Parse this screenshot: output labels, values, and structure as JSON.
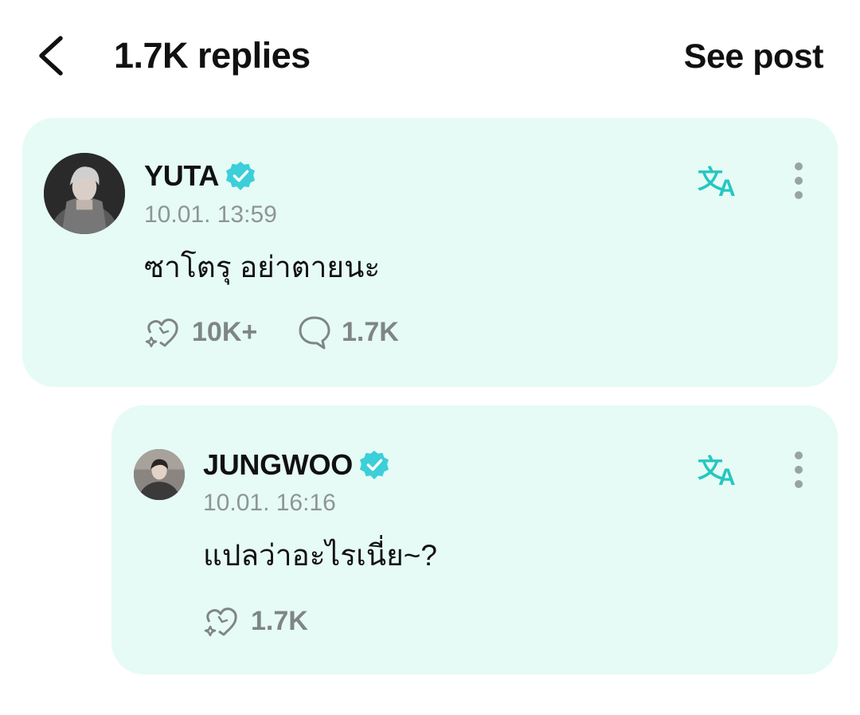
{
  "header": {
    "title": "1.7K replies",
    "see_post_label": "See post"
  },
  "post": {
    "author": "YUTA",
    "timestamp": "10.01. 13:59",
    "text": "ซาโตรุ อย่าตายนะ",
    "likes": "10K+",
    "replies": "1.7K"
  },
  "reply": {
    "author": "JUNGWOO",
    "timestamp": "10.01. 16:16",
    "text": "แปลว่าอะไรเนี่ย~?",
    "likes": "1.7K"
  },
  "icons": {
    "back": "chevron-left-icon",
    "verified": "verified-badge-icon",
    "translate": "translate-icon",
    "more": "more-vertical-icon",
    "like": "sparkle-heart-icon",
    "comment": "speech-bubble-icon"
  },
  "colors": {
    "card_background": "#e6fbf5",
    "accent": "#25c7c0",
    "verified": "#3ccfd9",
    "muted_text": "#8f9596",
    "dots": "#9aa3a3"
  }
}
